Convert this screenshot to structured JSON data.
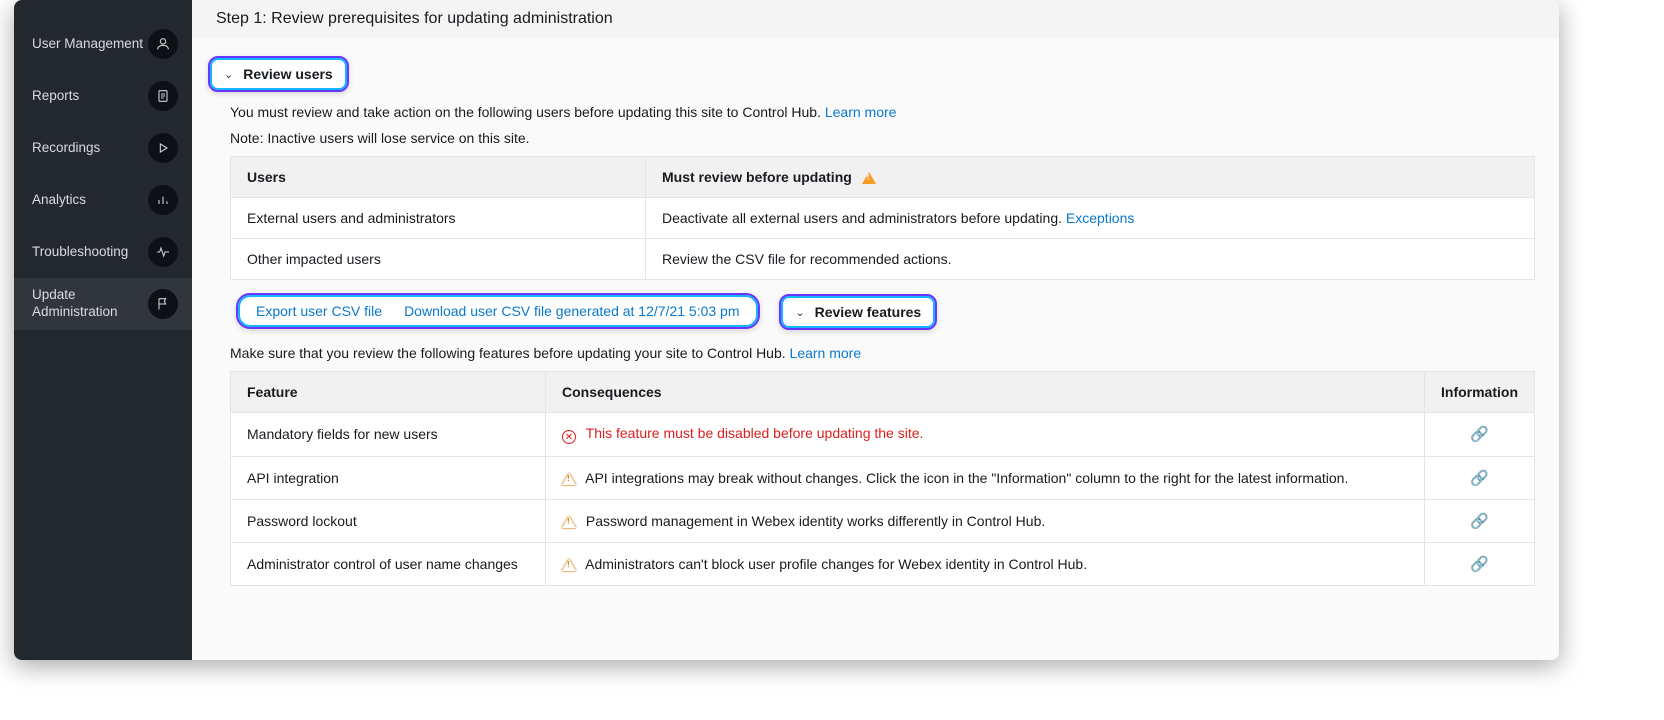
{
  "sidebar": {
    "items": [
      {
        "label": "User Management",
        "icon": "user-icon"
      },
      {
        "label": "Reports",
        "icon": "document-icon"
      },
      {
        "label": "Recordings",
        "icon": "play-icon"
      },
      {
        "label": "Analytics",
        "icon": "bar-chart-icon"
      },
      {
        "label": "Troubleshooting",
        "icon": "activity-icon"
      },
      {
        "label": "Update Administration",
        "icon": "flag-icon"
      }
    ]
  },
  "step_title": "Step 1: Review prerequisites for updating administration",
  "review_users": {
    "title": "Review users",
    "intro": "You must review and take action on the following users before updating this site to Control Hub. ",
    "learn_more": "Learn more",
    "note": "Note: Inactive users will lose service on this site.",
    "columns": {
      "users": "Users",
      "must": "Must review before updating"
    },
    "rows": [
      {
        "users": "External users and administrators",
        "action": "Deactivate all external users and administrators before updating. ",
        "link": "Exceptions"
      },
      {
        "users": "Other impacted users",
        "action": "Review the CSV file for recommended actions.",
        "link": ""
      }
    ],
    "export_label": "Export user CSV file",
    "download_label": "Download user CSV file generated at 12/7/21 5:03 pm"
  },
  "review_features": {
    "title": "Review features",
    "intro": "Make sure that you review the following features before updating your site to Control Hub. ",
    "learn_more": "Learn more",
    "columns": {
      "feature": "Feature",
      "cons": "Consequences",
      "info": "Information"
    },
    "rows": [
      {
        "feature": "Mandatory fields for new users",
        "cons": "This feature must be disabled before updating the site.",
        "severity": "error"
      },
      {
        "feature": "API integration",
        "cons": "API integrations may break without changes. Click the icon in the \"Information\" column to the right for the latest information.",
        "severity": "warn"
      },
      {
        "feature": "Password lockout",
        "cons": "Password management in Webex identity works differently in Control Hub.",
        "severity": "warn"
      },
      {
        "feature": "Administrator control of user name changes",
        "cons": "Administrators can't block user profile changes for Webex identity in Control Hub.",
        "severity": "warn"
      }
    ]
  }
}
